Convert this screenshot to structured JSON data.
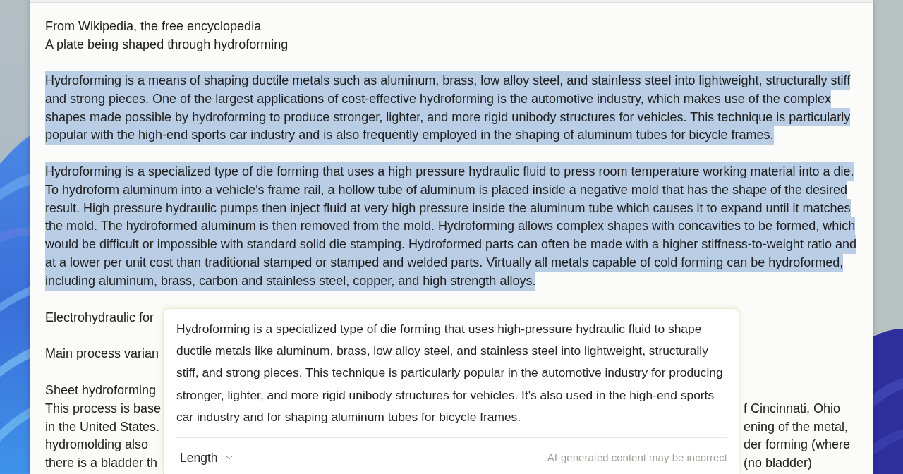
{
  "article": {
    "blocks": [
      {
        "lines": [
          "From Wikipedia, the free encyclopedia",
          "A plate being shaped through hydroforming"
        ],
        "selected": false
      },
      {
        "lines": [
          "Hydroforming is a means of shaping ductile metals such as aluminum, brass, low alloy steel, and stainless steel into lightweight, structurally stiff and strong pieces. One of the largest applications of cost-effective hydroforming is the automotive industry, which makes use of the complex shapes made possible by hydroforming to produce stronger, lighter, and more rigid unibody structures for vehicles. This technique is particularly popular with the high-end sports car industry and is also frequently employed in the shaping of aluminum tubes for bicycle frames."
        ],
        "selected": true
      },
      {
        "lines": [
          "Hydroforming is a specialized type of die forming that uses a high pressure hydraulic fluid to press room temperature working material into a die. To hydroform aluminum into a vehicle's frame rail, a hollow tube of aluminum is placed inside a negative mold that has the shape of the desired result. High pressure hydraulic pumps then inject fluid at very high pressure inside the aluminum tube which causes it to expand until it matches the mold. The hydroformed aluminum is then removed from the mold. Hydroforming allows complex shapes with concavities to be formed, which would be difficult or impossible with standard solid die stamping. Hydroformed parts can often be made with a higher stiffness-to-weight ratio and at a lower per unit cost than traditional stamped or stamped and welded parts. Virtually all metals capable of cold forming can be hydroformed, including aluminum, brass, carbon and stainless steel, copper, and high strength alloys."
        ],
        "selected": true
      }
    ],
    "covered_blocks": [
      {
        "rows": [
          {
            "left": "Electrohydraulic for"
          }
        ]
      },
      {
        "rows": [
          {
            "left": "Main process varian"
          }
        ]
      },
      {
        "rows": [
          {
            "left": "Sheet hydroforming"
          },
          {
            "left": "This process is base",
            "right": "f Cincinnati, Ohio"
          },
          {
            "left": "in the United States.",
            "right": "ening of the metal,"
          },
          {
            "left": "hydromolding also",
            "right": "der forming (where"
          },
          {
            "left": "there is a bladder th",
            "right": "(no bladder)"
          }
        ]
      }
    ]
  },
  "summary_popup": {
    "text": "Hydroforming is a specialized type of die forming that uses high-pressure hydraulic fluid to shape ductile metals like aluminum, brass, low alloy steel, and stainless steel into lightweight, structurally stiff, and strong pieces. This technique is particularly popular in the automotive industry for producing stronger, lighter, and more rigid unibody structures for vehicles. It's also used in the high-end sports car industry and for shaping aluminum tubes for bicycle frames.",
    "length_button": "Length",
    "disclaimer": "AI-generated content may be incorrect"
  }
}
